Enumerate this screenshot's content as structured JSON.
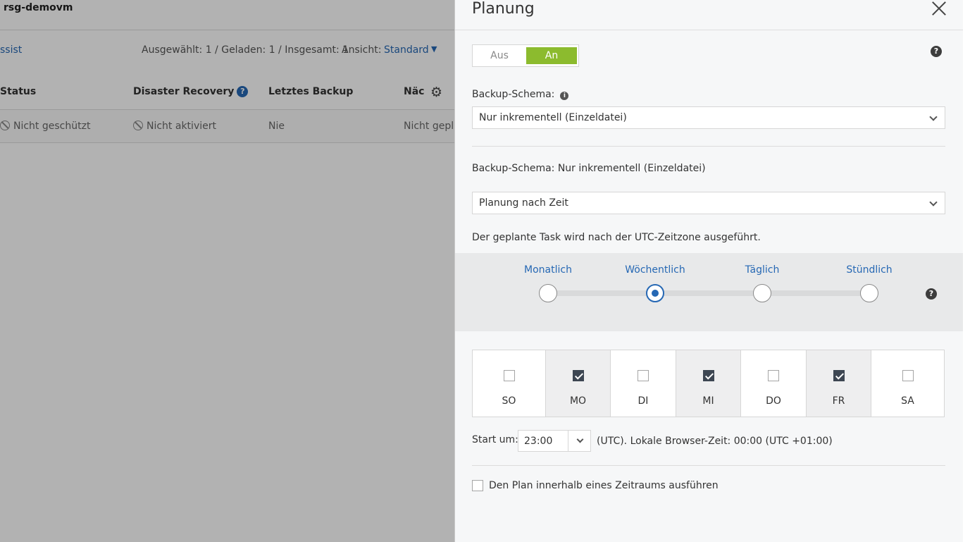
{
  "background": {
    "title": "rsg-demovm",
    "toolbar": {
      "assist_link": "ssist",
      "counts": "Ausgewählt: 1 / Geladen: 1 / Insgesamt: 1",
      "view_label": "Ansicht:",
      "view_value": "Standard"
    },
    "columns": [
      "Status",
      "Disaster Recovery",
      "Letztes Backup",
      "Näc"
    ],
    "row": {
      "status": "Nicht geschützt",
      "disaster_recovery": "Nicht aktiviert",
      "last_backup": "Nie",
      "next": "Nicht gepla"
    }
  },
  "drawer": {
    "title": "Planung",
    "toggle": {
      "off_label": "Aus",
      "on_label": "An",
      "state": "An"
    },
    "scheme_label": "Backup-Schema:",
    "scheme_value": "Nur inkrementell (Einzeldatei)",
    "scheme_summary": "Backup-Schema: Nur inkrementell (Einzeldatei)",
    "schedule_type": "Planung nach Zeit",
    "timezone_note": "Der geplante Task wird nach der UTC-Zeitzone ausgeführt.",
    "frequency": {
      "options": [
        "Monatlich",
        "Wöchentlich",
        "Täglich",
        "Stündlich"
      ],
      "selected": "Wöchentlich"
    },
    "days": [
      {
        "label": "SO",
        "checked": false
      },
      {
        "label": "MO",
        "checked": true
      },
      {
        "label": "DI",
        "checked": false
      },
      {
        "label": "MI",
        "checked": true
      },
      {
        "label": "DO",
        "checked": false
      },
      {
        "label": "FR",
        "checked": true
      },
      {
        "label": "SA",
        "checked": false
      }
    ],
    "start_label": "Start um:",
    "start_time": "23:00",
    "local_time_note": "(UTC). Lokale Browser-Zeit: 00:00 (UTC +01:00)",
    "period_checkbox_label": "Den Plan innerhalb eines Zeitraums ausführen",
    "period_checked": false
  },
  "colors": {
    "accent_blue": "#2668b4",
    "toggle_green": "#8cbb2e",
    "checkbox_dark": "#3d4652"
  }
}
